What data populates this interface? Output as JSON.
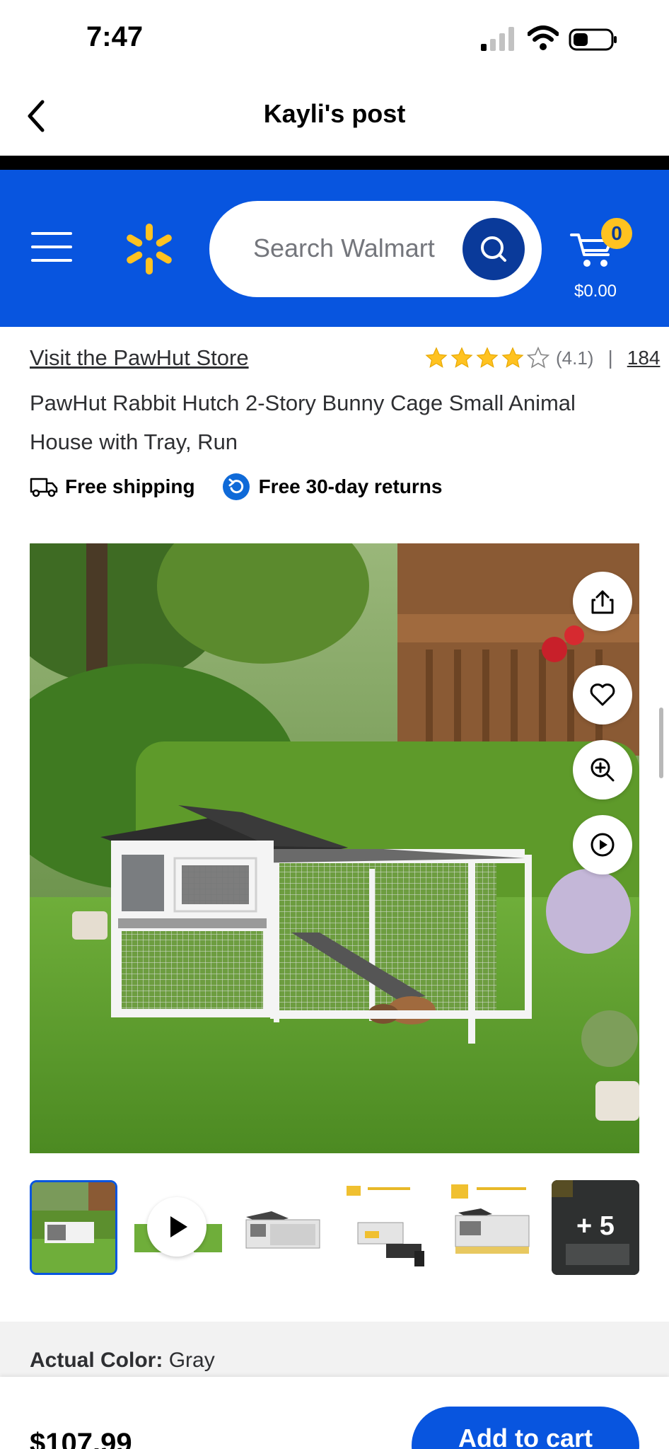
{
  "status_bar": {
    "time": "7:47"
  },
  "nav": {
    "title": "Kayli's post"
  },
  "header": {
    "search_placeholder": "Search Walmart",
    "cart_count": "0",
    "cart_total": "$0.00",
    "brand_color": "#0855df",
    "spark_color": "#ffc220"
  },
  "product": {
    "store_link": "Visit the PawHut Store",
    "rating_value": 4.1,
    "rating_text": "(4.1)",
    "rating_separator": "|",
    "review_count": "184",
    "title": "PawHut Rabbit Hutch 2-Story Bunny Cage Small Animal House with Tray, Run",
    "badges": [
      {
        "icon": "truck-icon",
        "label": "Free shipping"
      },
      {
        "icon": "return-icon",
        "label": "Free 30-day returns"
      }
    ],
    "image_actions": [
      "share-icon",
      "heart-icon",
      "zoom-in-icon",
      "play-icon"
    ],
    "thumbnails": [
      {
        "type": "image",
        "selected": true
      },
      {
        "type": "video"
      },
      {
        "type": "image"
      },
      {
        "type": "image"
      },
      {
        "type": "image"
      },
      {
        "type": "more",
        "label": "+ 5"
      }
    ],
    "color_label": "Actual Color:",
    "color_value": "Gray"
  },
  "bottom_bar": {
    "price": "$107.99",
    "add_to_cart": "Add to cart"
  }
}
